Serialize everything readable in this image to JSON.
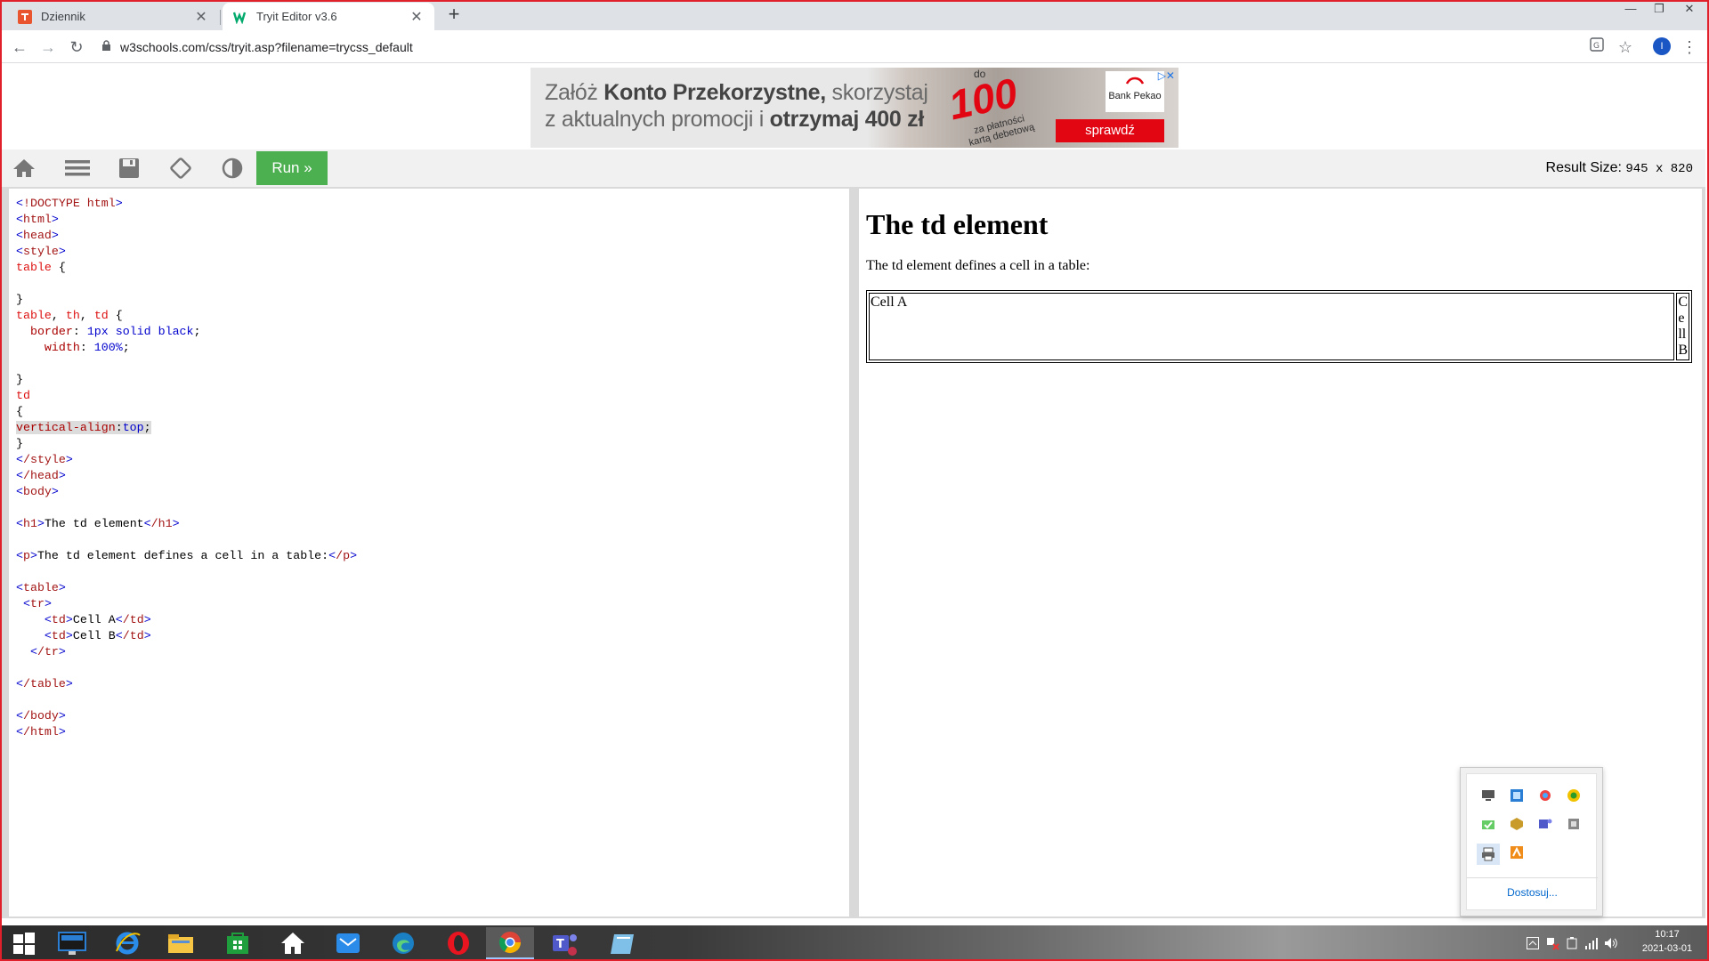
{
  "browser": {
    "tabs": [
      {
        "label": "Dziennik"
      },
      {
        "label": "Tryit Editor v3.6"
      }
    ],
    "url": "w3schools.com/css/tryit.asp?filename=trycss_default",
    "profile_initial": "I"
  },
  "ad": {
    "line1_a": "Załóż ",
    "line1_b": "Konto Przekorzystne,",
    "line1_c": " skorzystaj",
    "line2_a": "z aktualnych promocji i ",
    "line2_b": "otrzymaj 400 zł",
    "do_label": "do",
    "big_number": "100",
    "card_text": "za płatności kartą debetową",
    "bank": "Bank Pekao",
    "cta": "sprawdź"
  },
  "tryit": {
    "run_label": "Run »",
    "result_size_label": "Result Size:",
    "result_size_value": "945 x 820"
  },
  "code_lines": [
    "<!DOCTYPE html>",
    "<html>",
    "<head>",
    "<style>",
    "table {",
    "",
    "}",
    "table, th, td {",
    "  border: 1px solid black;",
    "    width: 100%;",
    "",
    "}",
    "td",
    "{",
    "vertical-align:top;",
    "}",
    "</style>",
    "</head>",
    "<body>",
    "",
    "<h1>The td element</h1>",
    "",
    "<p>The td element defines a cell in a table:</p>",
    "",
    "<table>",
    " <tr>",
    "    <td>Cell A</td>",
    "    <td>Cell B</td>",
    "  </tr>",
    "",
    "</table>",
    "",
    "</body>",
    "</html>"
  ],
  "result": {
    "heading": "The td element",
    "paragraph": "The td element defines a cell in a table:",
    "cell_a": "Cell A",
    "cell_b": "Cell B"
  },
  "tray": {
    "customize": "Dostosuj..."
  },
  "clock": {
    "time": "10:17",
    "date": "2021-03-01"
  },
  "colors": {
    "run_button": "#4caf50",
    "window_frame": "#e0202a",
    "ad_cta": "#e20613"
  }
}
